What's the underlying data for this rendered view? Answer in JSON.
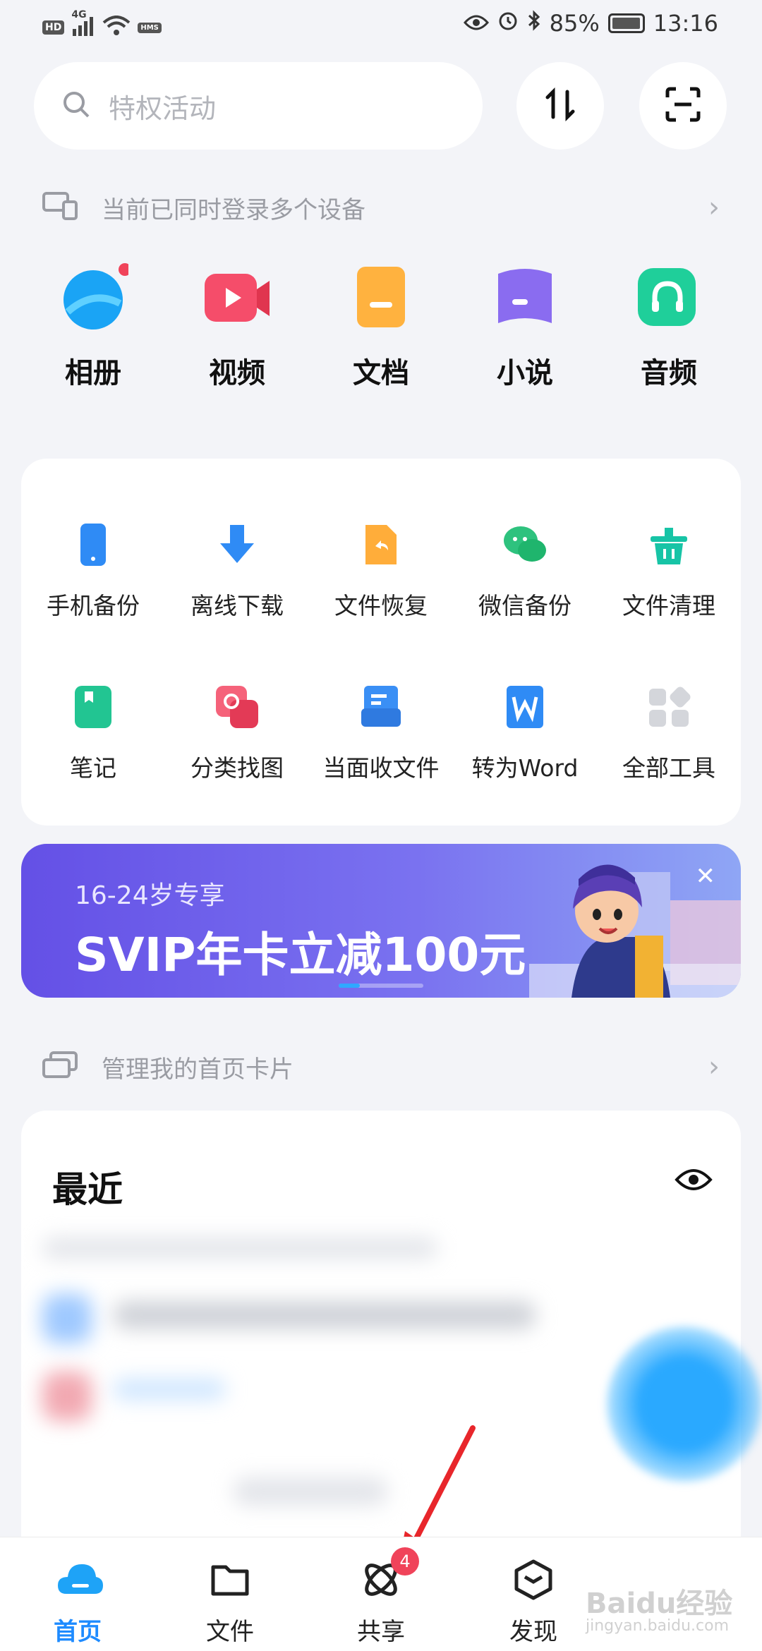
{
  "status": {
    "left_chips": [
      "HD",
      "4G",
      "HMS"
    ],
    "battery": "85%",
    "time": "13:16"
  },
  "search": {
    "placeholder": "特权活动"
  },
  "devices_row": {
    "text": "当前已同时登录多个设备"
  },
  "categories": [
    {
      "label": "相册",
      "icon": "photo-album-icon"
    },
    {
      "label": "视频",
      "icon": "video-icon"
    },
    {
      "label": "文档",
      "icon": "document-icon"
    },
    {
      "label": "小说",
      "icon": "novel-icon"
    },
    {
      "label": "音频",
      "icon": "audio-icon"
    }
  ],
  "tools": [
    {
      "label": "手机备份",
      "icon": "phone-backup-icon"
    },
    {
      "label": "离线下载",
      "icon": "offline-download-icon"
    },
    {
      "label": "文件恢复",
      "icon": "file-restore-icon"
    },
    {
      "label": "微信备份",
      "icon": "wechat-backup-icon"
    },
    {
      "label": "文件清理",
      "icon": "file-clean-icon"
    },
    {
      "label": "笔记",
      "icon": "notes-icon"
    },
    {
      "label": "分类找图",
      "icon": "photo-category-icon"
    },
    {
      "label": "当面收文件",
      "icon": "receive-files-icon"
    },
    {
      "label": "转为Word",
      "icon": "word-convert-icon"
    },
    {
      "label": "全部工具",
      "icon": "all-tools-icon"
    }
  ],
  "banner": {
    "subtitle": "16-24岁专享",
    "headline": "SVIP年卡立减100元",
    "close": "✕"
  },
  "cards_row": {
    "text": "管理我的首页卡片"
  },
  "recent": {
    "title": "最近"
  },
  "bottom_nav": [
    {
      "label": "首页",
      "active": true
    },
    {
      "label": "文件",
      "active": false
    },
    {
      "label": "共享",
      "active": false,
      "badge": "4"
    },
    {
      "label": "发现",
      "active": false
    }
  ],
  "watermark": {
    "text": "Baidu经验",
    "sub": "jingyan.baidu.com"
  },
  "colors": {
    "accent": "#1e8bff",
    "badge": "#f0435a",
    "banner_start": "#6450e6"
  }
}
